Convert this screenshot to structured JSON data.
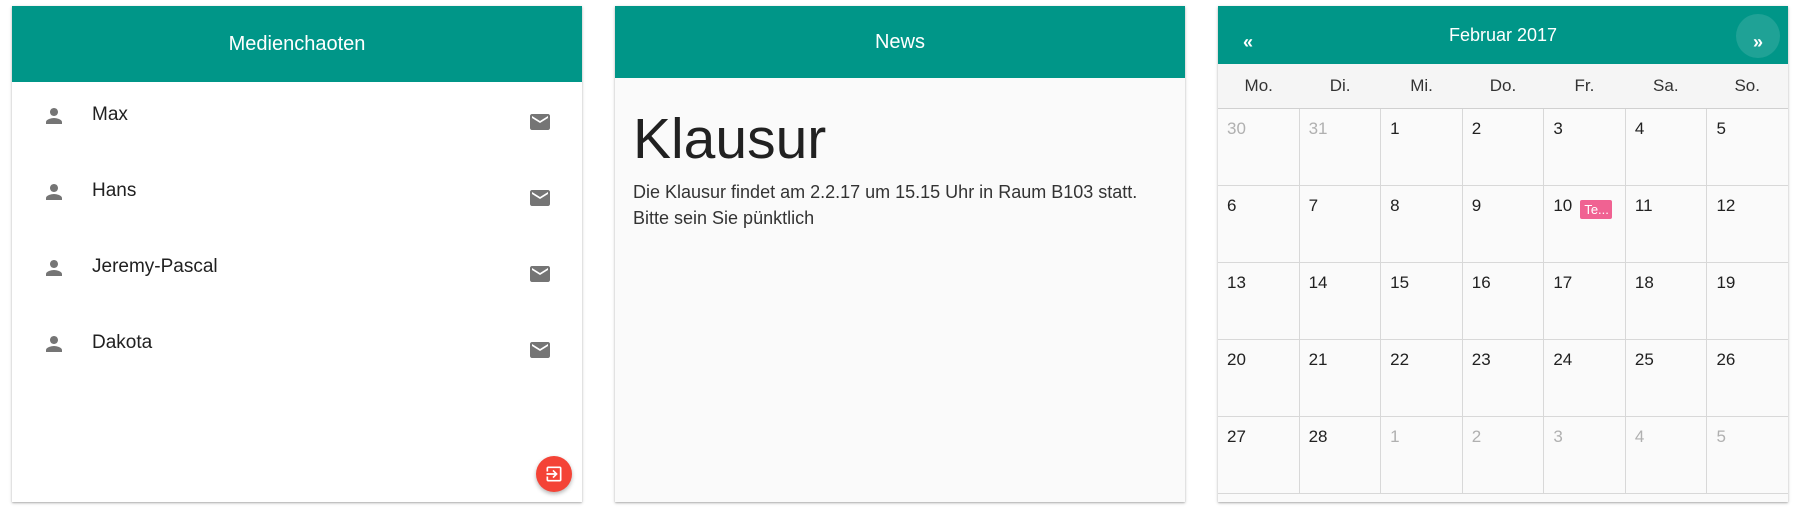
{
  "members": {
    "title": "Medienchaoten",
    "list": [
      "Max",
      "Hans",
      "Jeremy-Pascal",
      "Dakota"
    ],
    "fab_icon": "exit-to-app-icon",
    "fab_color": "#f44336"
  },
  "news": {
    "header": "News",
    "title": "Klausur",
    "text": "Die Klausur findet am 2.2.17 um 15.15 Uhr in Raum B103 statt. Bitte sein Sie pünktlich"
  },
  "calendar": {
    "month": "Februar 2017",
    "prev": "«",
    "next": "»",
    "weekdays": [
      "Mo.",
      "Di.",
      "Mi.",
      "Do.",
      "Fr.",
      "Sa.",
      "So."
    ],
    "weeks": [
      [
        {
          "d": "30",
          "other": true
        },
        {
          "d": "31",
          "other": true
        },
        {
          "d": "1"
        },
        {
          "d": "2"
        },
        {
          "d": "3"
        },
        {
          "d": "4"
        },
        {
          "d": "5"
        }
      ],
      [
        {
          "d": "6"
        },
        {
          "d": "7"
        },
        {
          "d": "8"
        },
        {
          "d": "9"
        },
        {
          "d": "10",
          "event": "Te..."
        },
        {
          "d": "11"
        },
        {
          "d": "12"
        }
      ],
      [
        {
          "d": "13"
        },
        {
          "d": "14"
        },
        {
          "d": "15"
        },
        {
          "d": "16"
        },
        {
          "d": "17"
        },
        {
          "d": "18"
        },
        {
          "d": "19"
        }
      ],
      [
        {
          "d": "20"
        },
        {
          "d": "21"
        },
        {
          "d": "22"
        },
        {
          "d": "23"
        },
        {
          "d": "24"
        },
        {
          "d": "25"
        },
        {
          "d": "26"
        }
      ],
      [
        {
          "d": "27"
        },
        {
          "d": "28"
        },
        {
          "d": "1",
          "other": true
        },
        {
          "d": "2",
          "other": true
        },
        {
          "d": "3",
          "other": true
        },
        {
          "d": "4",
          "other": true
        },
        {
          "d": "5",
          "other": true
        }
      ]
    ],
    "event_color": "#f06292"
  },
  "colors": {
    "header": "#009688"
  }
}
